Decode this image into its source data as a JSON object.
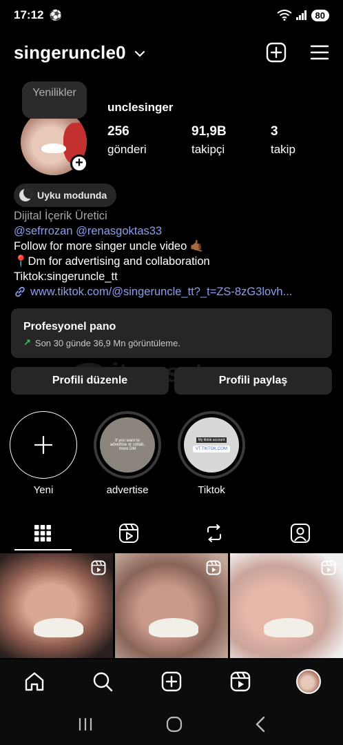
{
  "status_bar": {
    "time": "17:12",
    "battery": "80"
  },
  "header": {
    "username": "singeruncle0"
  },
  "profile": {
    "note_text": "Yenilikler",
    "display_name": "unclesinger",
    "stats": [
      {
        "value": "256",
        "label": "gönderi"
      },
      {
        "value": "91,9B",
        "label": "takipçi"
      },
      {
        "value": "3",
        "label": "takip"
      }
    ],
    "status_pill": "Uyku modunda",
    "bio": {
      "category": "Dijital İçerik Üretici",
      "mentions": "@sefrrozan @renasgoktas33",
      "line1": "Follow for more singer uncle video 🤙🏾",
      "line2": "📍Dm for advertising and collaboration",
      "line3": "Tiktok:singeruncle_tt",
      "link": "www.tiktok.com/@singeruncle_tt?_t=ZS-8zG3lovh..."
    }
  },
  "pro_panel": {
    "title": "Profesyonel pano",
    "subtitle": "Son 30 günde 36,9 Mn görüntüleme."
  },
  "watermark": "itemsatış",
  "buttons": {
    "edit": "Profili düzenle",
    "share": "Profili paylaş"
  },
  "highlights": [
    {
      "label": "Yeni"
    },
    {
      "label": "advertise",
      "inner_text": "If you want to advertise or collab, more DM"
    },
    {
      "label": "Tiktok",
      "inner_top": "My tiktok account",
      "inner_chip": "VT.TIKTOK.COM"
    }
  ],
  "tabs": [
    "grid-icon",
    "reels-icon",
    "reposts-icon",
    "tagged-icon"
  ],
  "colors": {
    "background": "#000000",
    "surface": "#262626",
    "link": "#8e9cf0",
    "growth": "#49c46b"
  }
}
